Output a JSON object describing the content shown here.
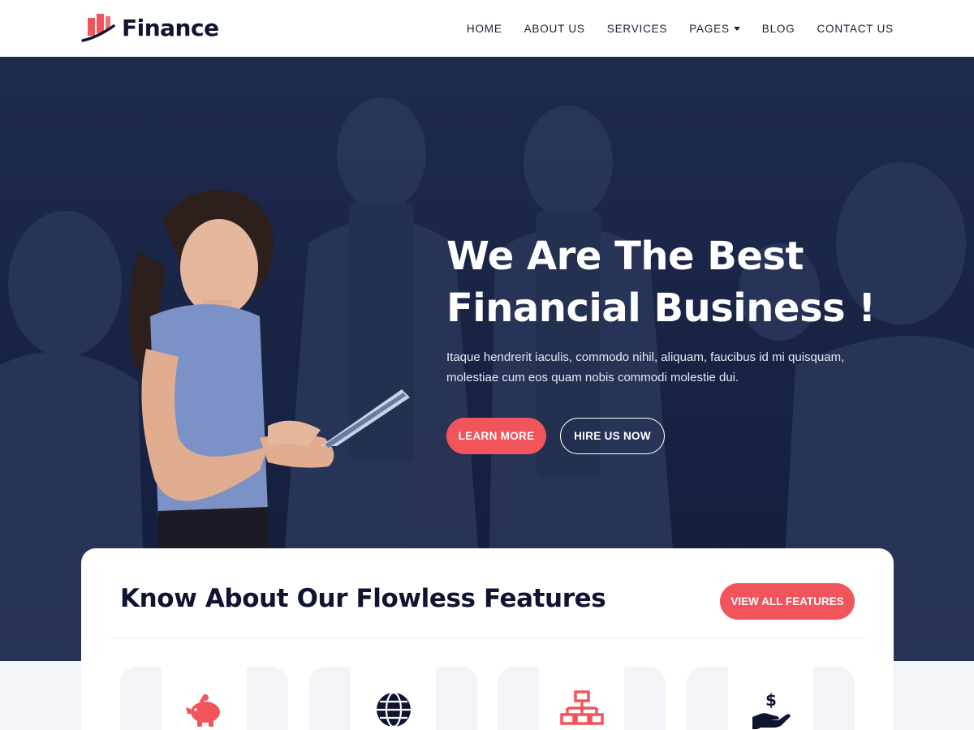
{
  "brand": {
    "name": "Finance",
    "accent": "#f2545b",
    "navy": "#0f1430",
    "hero_bg": "#1a2547"
  },
  "nav": {
    "items": [
      {
        "label": "HOME"
      },
      {
        "label": "ABOUT US"
      },
      {
        "label": "SERVICES"
      },
      {
        "label": "PAGES",
        "has_dropdown": true
      },
      {
        "label": "BLOG"
      },
      {
        "label": "CONTACT US"
      }
    ]
  },
  "hero": {
    "title_line1": "We Are The Best",
    "title_line2": "Financial Business !",
    "text_line1": "Itaque hendrerit iaculis, commodo nihil, aliquam, faucibus id mi quisquam,",
    "text_line2": "molestiae cum eos quam nobis commodi molestie dui.",
    "learn_more": "LEARN MORE",
    "hire_us": "HIRE US NOW"
  },
  "features": {
    "title": "Know About Our Flowless Features",
    "view_all": "VIEW ALL FEATURES",
    "cards": [
      {
        "icon": "piggy-bank-icon",
        "color": "#f2545b"
      },
      {
        "icon": "globe-icon",
        "color": "#0f1430"
      },
      {
        "icon": "network-icon",
        "color": "#f2545b"
      },
      {
        "icon": "hand-dollar-icon",
        "color": "#0f1430"
      }
    ]
  }
}
